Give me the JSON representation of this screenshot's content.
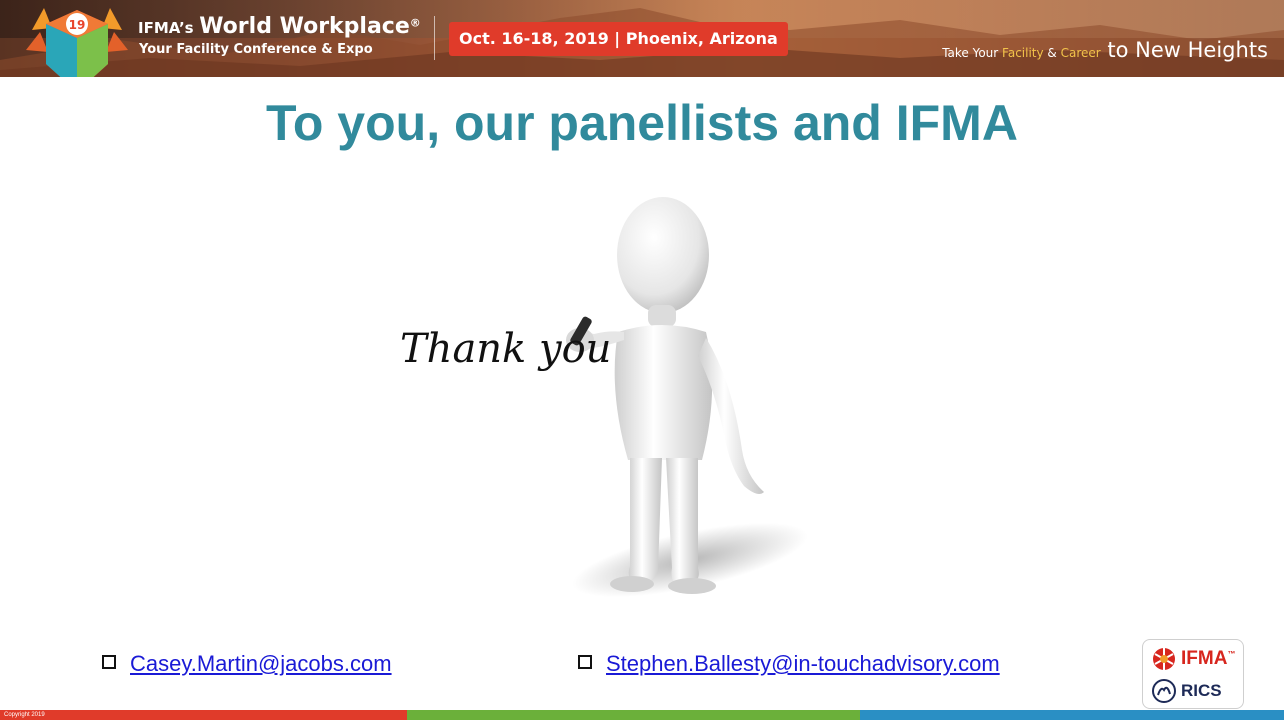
{
  "header": {
    "brand_small": "IFMA’s",
    "brand_big": "World Workplace",
    "brand_reg": "®",
    "subtitle": "Your Facility Conference & Expo",
    "date_location": "Oct. 16-18, 2019 | Phoenix, Arizona",
    "tagline_pre": "Take Your ",
    "tagline_facility": "Facility",
    "tagline_amp": " & ",
    "tagline_career": "Career",
    "tagline_post": " to New Heights",
    "logo_badge": "19"
  },
  "slide": {
    "title": "To you, our panellists and IFMA",
    "handwriting": "Thank you"
  },
  "contacts": [
    {
      "email": "Casey.Martin@jacobs.com"
    },
    {
      "email": "Stephen.Ballesty@in-touchadvisory.com"
    }
  ],
  "partners": {
    "ifma": "IFMA",
    "ifma_tm": "™",
    "rics": "RICS"
  },
  "footer": {
    "copyright": "Copyright 2019"
  },
  "colors": {
    "title": "#318a9c",
    "date_pill": "#e03b2a",
    "link": "#1a1ad6",
    "strip_red": "#e03b2a",
    "strip_green": "#6bb03a",
    "strip_blue": "#2a8fc4"
  },
  "icons": [
    "conference-logo-icon",
    "checkbox-icon",
    "ifma-logo-icon",
    "rics-logo-icon"
  ]
}
